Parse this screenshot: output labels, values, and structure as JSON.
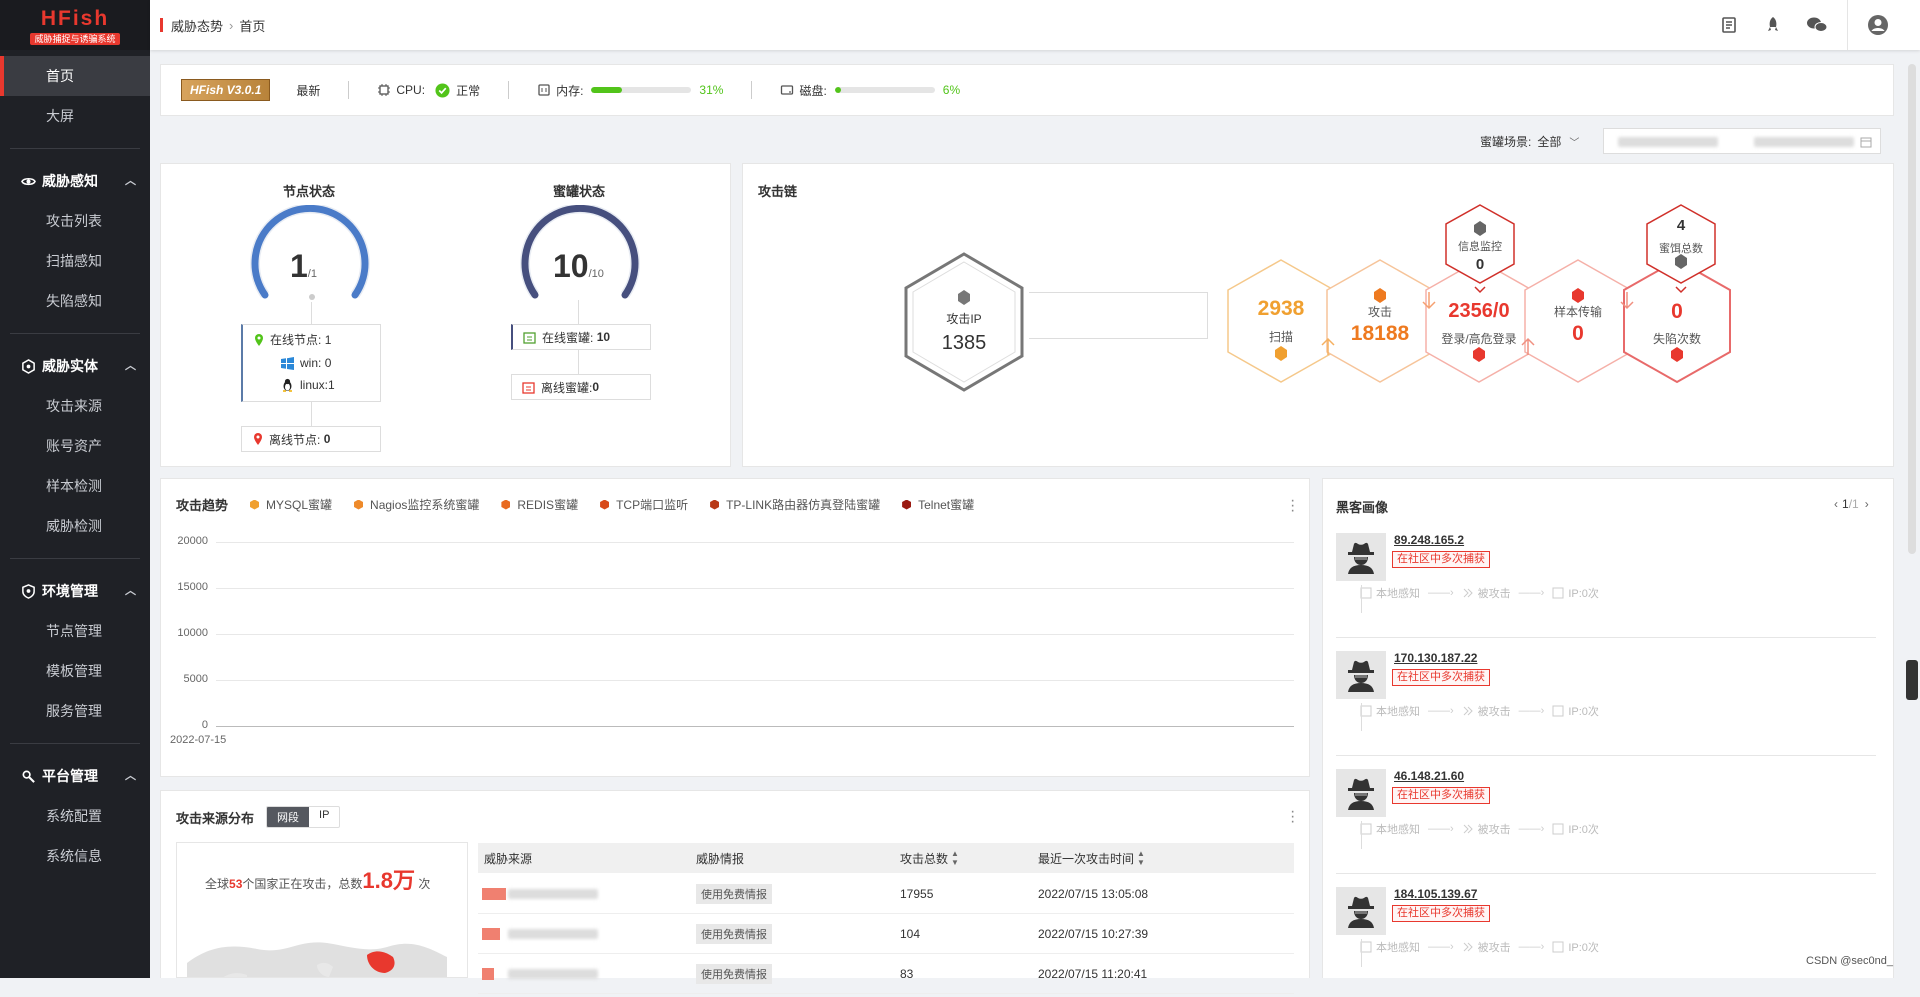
{
  "app": {
    "brand": "HFish",
    "subtitle": "威胁捕捉与诱骗系统"
  },
  "sidebar": {
    "home": "首页",
    "bigscreen": "大屏",
    "groups": [
      {
        "label": "威胁感知",
        "items": [
          "攻击列表",
          "扫描感知",
          "失陷感知"
        ]
      },
      {
        "label": "威胁实体",
        "items": [
          "攻击来源",
          "账号资产",
          "样本检测",
          "威胁检测"
        ]
      },
      {
        "label": "环境管理",
        "items": [
          "节点管理",
          "模板管理",
          "服务管理"
        ]
      },
      {
        "label": "平台管理",
        "items": [
          "系统配置",
          "系统信息"
        ]
      }
    ]
  },
  "breadcrumb": {
    "root": "威胁态势",
    "current": "首页"
  },
  "statusbar": {
    "version": "HFish V3.0.1",
    "version_state": "最新",
    "cpu_label": "CPU:",
    "cpu_status": "正常",
    "mem_label": "内存:",
    "mem_pct": "31%",
    "mem_value": 0.31,
    "disk_label": "磁盘:",
    "disk_pct": "6%",
    "disk_value": 0.06
  },
  "filter": {
    "label": "蜜罐场景:",
    "value": "全部"
  },
  "node_status": {
    "title": "节点状态",
    "value": "1",
    "total": "/1",
    "online_label": "在线节点:",
    "online_value": "1",
    "win_label": "win:",
    "win_value": "0",
    "linux_label": "linux:",
    "linux_value": "1",
    "offline_label": "离线节点:",
    "offline_value": "0"
  },
  "honeypot_status": {
    "title": "蜜罐状态",
    "value": "10",
    "total": "/10",
    "online_label": "在线蜜罐:",
    "online_value": "10",
    "offline_label": "离线蜜罐:",
    "offline_value": "0"
  },
  "attack_chain": {
    "title": "攻击链",
    "attack_ip_label": "攻击IP",
    "attack_ip_value": "1385",
    "scan_value": "2938",
    "scan_label": "扫描",
    "attack_value": "18188",
    "attack_label": "攻击",
    "login_value": "2356/0",
    "login_label": "登录/高危登录",
    "sample_label": "样本传输",
    "sample_value": "0",
    "fallen_value": "0",
    "fallen_label": "失陷次数",
    "info_monitor_label": "信息监控",
    "info_monitor_value": "0",
    "bait_label": "蜜饵总数",
    "bait_value": "4"
  },
  "trend": {
    "title": "攻击趋势",
    "legend": [
      {
        "name": "MYSQL蜜罐",
        "color": "#f0a030"
      },
      {
        "name": "Nagios监控系统蜜罐",
        "color": "#ee8a2a"
      },
      {
        "name": "REDIS蜜罐",
        "color": "#e86a20"
      },
      {
        "name": "TCP端口监听",
        "color": "#d84a1a"
      },
      {
        "name": "TP-LINK路由器仿真登陆蜜罐",
        "color": "#b83a18"
      },
      {
        "name": "Telnet蜜罐",
        "color": "#9a1a12"
      }
    ],
    "y_ticks": [
      "20000",
      "15000",
      "10000",
      "5000",
      "0"
    ],
    "x_label": "2022-07-15"
  },
  "hacker": {
    "title": "黑客画像",
    "page": "1",
    "page_total": "/1",
    "items": [
      {
        "ip": "89.248.165.2",
        "tag": "在社区中多次捕获"
      },
      {
        "ip": "170.130.187.22",
        "tag": "在社区中多次捕获"
      },
      {
        "ip": "46.148.21.60",
        "tag": "在社区中多次捕获"
      },
      {
        "ip": "184.105.139.67",
        "tag": "在社区中多次捕获"
      }
    ],
    "chain": {
      "step1": "本地感知",
      "step2": "被攻击",
      "step3": "IP:0次"
    }
  },
  "source": {
    "title": "攻击来源分布",
    "tab_segment": "网段",
    "tab_ip": "IP",
    "summary_prefix": "全球",
    "summary_count": "53",
    "summary_mid": "个国家正在攻击，总数",
    "summary_total": "1.8万",
    "summary_suffix": "次",
    "columns": [
      "威胁来源",
      "威胁情报",
      "攻击总数",
      "最近一次攻击时间"
    ],
    "rows": [
      {
        "intel": "使用免费情报",
        "count": "17955",
        "time": "2022/07/15 13:05:08"
      },
      {
        "intel": "使用免费情报",
        "count": "104",
        "time": "2022/07/15 10:27:39"
      },
      {
        "intel": "使用免费情报",
        "count": "83",
        "time": "2022/07/15 11:20:41"
      }
    ]
  },
  "watermark": "CSDN @sec0nd_"
}
